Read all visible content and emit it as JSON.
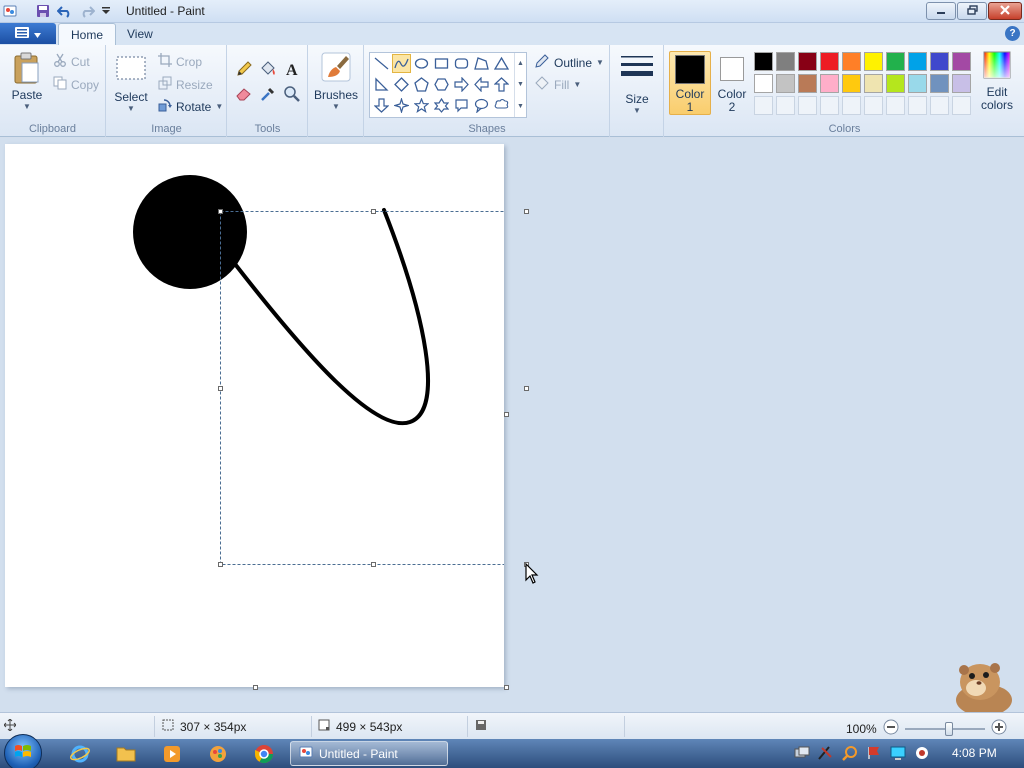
{
  "window": {
    "title": "Untitled - Paint",
    "minimize_icon": "minimize-icon",
    "maximize_icon": "restore-icon",
    "close_icon": "close-icon"
  },
  "quick_access": [
    "paint-app-icon",
    "save-icon",
    "undo-icon",
    "redo-icon",
    "customize-dropdown-icon"
  ],
  "tabs": [
    {
      "label": "Home",
      "active": true
    },
    {
      "label": "View",
      "active": false
    }
  ],
  "ribbon": {
    "clipboard": {
      "label": "Clipboard",
      "paste": "Paste",
      "cut": "Cut",
      "copy": "Copy"
    },
    "image": {
      "label": "Image",
      "select": "Select",
      "crop": "Crop",
      "resize": "Resize",
      "rotate": "Rotate"
    },
    "tools": {
      "label": "Tools",
      "items": [
        "pencil-icon",
        "fill-bucket-icon",
        "text-icon",
        "eraser-icon",
        "color-picker-icon",
        "magnifier-icon"
      ]
    },
    "brushes": {
      "label": "Brushes"
    },
    "shapes": {
      "label": "Shapes",
      "outline": "Outline",
      "fill": "Fill",
      "selected": "curve-shape"
    },
    "size": {
      "label": "Size"
    },
    "colors": {
      "label": "Colors",
      "color1": {
        "label1": "Color",
        "label2": "1",
        "value": "#000000"
      },
      "color2": {
        "label1": "Color",
        "label2": "2",
        "value": "#ffffff"
      },
      "edit": {
        "label1": "Edit",
        "label2": "colors"
      },
      "palette_row1": [
        "#000000",
        "#7f7f7f",
        "#880015",
        "#ed1c24",
        "#ff7f27",
        "#fff200",
        "#22b14c",
        "#00a2e8",
        "#3f48cc",
        "#a349a4"
      ],
      "palette_row2": [
        "#ffffff",
        "#c3c3c3",
        "#b97a57",
        "#ffaec9",
        "#ffc90e",
        "#efe4b0",
        "#b5e61d",
        "#99d9ea",
        "#7092be",
        "#c8bfe7"
      ]
    }
  },
  "status": {
    "selection_size": "307 × 354px",
    "canvas_size": "499 × 543px",
    "zoom": "100%"
  },
  "taskbar": {
    "task_label": "Untitled - Paint",
    "clock": "4:08 PM"
  }
}
